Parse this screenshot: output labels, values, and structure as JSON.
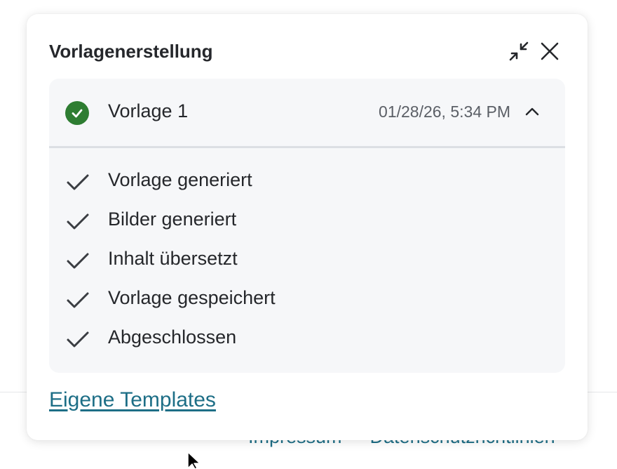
{
  "panel": {
    "title": "Vorlagenerstellung",
    "collapse_icon": "collapse-arrows-icon",
    "close_icon": "close-icon"
  },
  "job": {
    "name": "Vorlage 1",
    "timestamp": "01/28/26, 5:34 PM",
    "status": "completed",
    "status_color": "#2e7d32",
    "expanded": true,
    "steps": [
      {
        "label": "Vorlage generiert",
        "done": true
      },
      {
        "label": "Bilder generiert",
        "done": true
      },
      {
        "label": "Inhalt übersetzt",
        "done": true
      },
      {
        "label": "Vorlage gespeichert",
        "done": true
      },
      {
        "label": "Abgeschlossen",
        "done": true
      }
    ]
  },
  "links": {
    "templates": "Eigene Templates"
  },
  "footer": {
    "impressum": "Impressum",
    "privacy": "Datenschutzrichtlinien"
  },
  "colors": {
    "link": "#1d6e86",
    "text": "#25272b",
    "card_bg": "#f6f7f9",
    "muted_text": "#5b5f66"
  }
}
